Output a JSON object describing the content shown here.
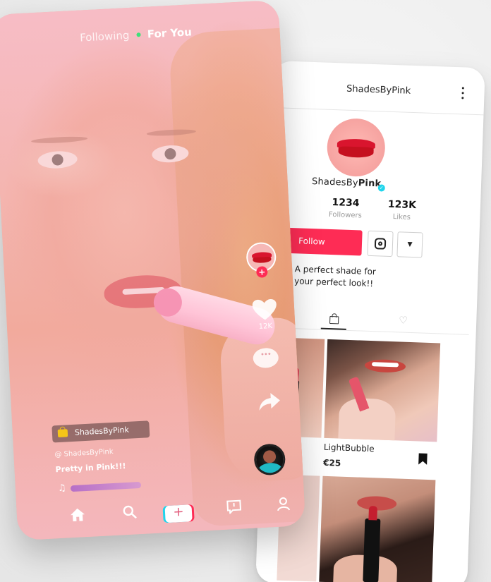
{
  "video": {
    "feed_tabs": {
      "following": "Following",
      "for_you": "For You"
    },
    "like_count": "12K",
    "shop_tag": "ShadesByPink",
    "handle": "@ ShadesByPink",
    "caption": "Pretty in Pink!!!",
    "nav": {
      "home": "",
      "search": "",
      "create": "",
      "inbox": "",
      "me": ""
    }
  },
  "profile": {
    "username": "ShadesByPink",
    "display_name_prefix": "ShadesBy",
    "display_name_bold": "Pink",
    "stats": [
      {
        "value": "0K",
        "label": "wing"
      },
      {
        "value": "1234",
        "label": "Followers"
      },
      {
        "value": "123K",
        "label": "Likes"
      }
    ],
    "follow_label": "Follow",
    "bio_line1": "A perfect shade for",
    "bio_line2": "your perfect look!!",
    "product": {
      "name": "LightBubble",
      "price": "€25"
    }
  },
  "colors": {
    "accent": "#fe2c55",
    "accent_teal": "#20d5ec",
    "online_dot": "#3ee07a"
  }
}
